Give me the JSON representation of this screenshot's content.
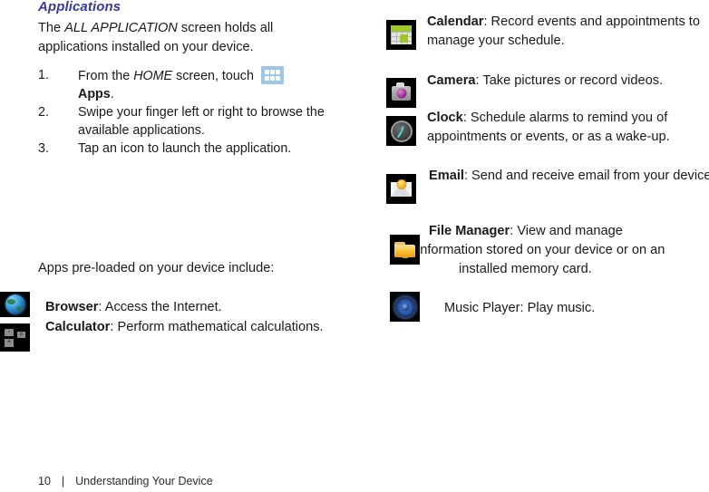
{
  "heading": "Applications",
  "intro": {
    "before": "The ",
    "emphasis": "ALL APPLICATION",
    "after": " screen holds all applications installed on your device."
  },
  "steps": [
    {
      "num": "1.",
      "part1": "From the ",
      "emphasis": "HOME",
      "part2": " screen, touch ",
      "icon": "apps-grid-icon",
      "bold_tail": "Apps",
      "tail": "."
    },
    {
      "num": "2.",
      "text": "Swipe your finger left or right to browse the available applications."
    },
    {
      "num": "3.",
      "text": "Tap an icon to launch the application."
    }
  ],
  "preloaded_label": "Apps pre-loaded on your device include:",
  "apps_left": [
    {
      "icon": "browser-globe-icon",
      "name": "Browser",
      "bold": true,
      "description": ": Access the Internet."
    },
    {
      "icon": "calculator-icon",
      "name": "Calculator",
      "bold": true,
      "description": ": Perform mathematical calculations."
    }
  ],
  "apps_right": [
    {
      "icon": "calendar-icon",
      "name": "Calendar",
      "bold": true,
      "description": ": Record events and appointments to manage your schedule."
    },
    {
      "icon": "camera-icon",
      "name": "Camera",
      "bold": true,
      "description": ": Take pictures or record videos."
    },
    {
      "icon": "clock-icon",
      "name": "Clock",
      "bold": true,
      "description": ": Schedule alarms to remind you of appointments or events, or as a wake-up."
    },
    {
      "icon": "email-icon",
      "name": "Email",
      "bold": true,
      "description": ": Send and receive email from your device."
    },
    {
      "icon": "file-manager-icon",
      "name": "File Manager",
      "bold": true,
      "line1": ": View and manage",
      "line2": "information stored on your device or on an",
      "line3": "installed memory card."
    },
    {
      "icon": "music-player-icon",
      "name": "Music Player",
      "bold": false,
      "description": ": Play music."
    }
  ],
  "calculator_keys": {
    "minus": "-",
    "plus": "+",
    "equals": "="
  },
  "footer": {
    "page_number": "10",
    "separator": "|",
    "section": "Understanding Your Device"
  },
  "colors": {
    "heading": "#3a3a9c",
    "body_text": "#1a1a1a",
    "apps_icon_bg": "#9dc6ea",
    "icon_tile_bg": "#000000",
    "calendar_green": "#9ec72b",
    "clock_teal": "#3fe0da",
    "email_yellow": "#f6b223",
    "folder_yellow": "#fcd34d",
    "music_blue": "#2a56a8"
  }
}
